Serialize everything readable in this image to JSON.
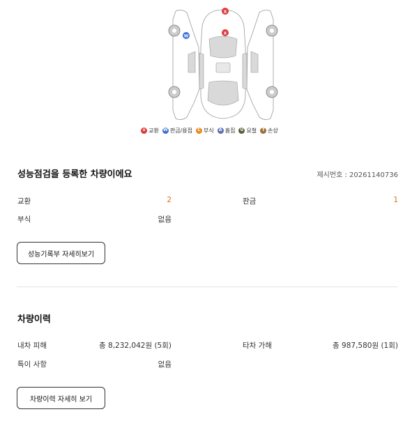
{
  "legend": [
    {
      "code": "X",
      "label": "교환",
      "color": "#e03a3a"
    },
    {
      "code": "W",
      "label": "판금/용접",
      "color": "#3d6fd6"
    },
    {
      "code": "C",
      "label": "부식",
      "color": "#e88a1a"
    },
    {
      "code": "A",
      "label": "흠집",
      "color": "#5a6fb5"
    },
    {
      "code": "U",
      "label": "요철",
      "color": "#555f3a"
    },
    {
      "code": "T",
      "label": "손상",
      "color": "#a0703a"
    }
  ],
  "diagram_markers": [
    {
      "code": "X",
      "color": "#e03a3a",
      "part": "front"
    },
    {
      "code": "X",
      "color": "#e03a3a",
      "part": "hood"
    },
    {
      "code": "W",
      "color": "#3d6fd6",
      "part": "left-front-fender"
    }
  ],
  "inspection": {
    "title": "성능점검을 등록한 차량이에요",
    "ref": "제시번호 : 20261140736",
    "rows": {
      "exchange_label": "교환",
      "exchange_value": "2",
      "panel_label": "판금",
      "panel_value": "1",
      "corrosion_label": "부식",
      "corrosion_value": "없음"
    },
    "button": "성능기록부 자세히보기"
  },
  "history": {
    "title": "차량이력",
    "rows": {
      "own_label": "내차 피해",
      "own_value": "총 8,232,042원 (5회)",
      "other_label": "타차 가해",
      "other_value": "총 987,580원 (1회)",
      "special_label": "특이 사항",
      "special_value": "없음"
    },
    "button": "차량이력 자세히 보기"
  }
}
